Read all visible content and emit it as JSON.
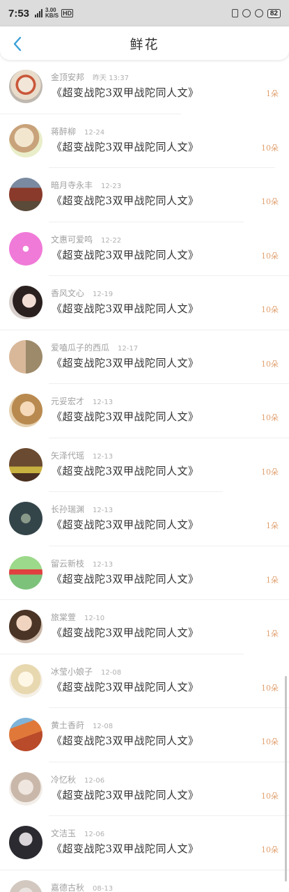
{
  "status_bar": {
    "time": "7:53",
    "net_speed_value": "3.00",
    "net_speed_unit": "KB/S",
    "hd": "HD",
    "battery": "82"
  },
  "header": {
    "title": "鲜花"
  },
  "colors": {
    "flower_count": "#e0a070",
    "meta_text": "#a0a0a0",
    "title_text": "#333333"
  },
  "rows": [
    {
      "name": "金顶安邦",
      "date": "昨天 13:37",
      "book": "《超变战陀3双甲战陀同人文》",
      "count": "1朵",
      "avatar": "food-bowl"
    },
    {
      "name": "蒋醉柳",
      "date": "12-24",
      "book": "《超变战陀3双甲战陀同人文》",
      "count": "10朵",
      "avatar": "girl-portrait"
    },
    {
      "name": "暗月寺永丰",
      "date": "12-23",
      "book": "《超变战陀3双甲战陀同人文》",
      "count": "10朵",
      "avatar": "temple-building"
    },
    {
      "name": "文惠可爱鸣",
      "date": "12-22",
      "book": "《超变战陀3双甲战陀同人文》",
      "count": "10朵",
      "avatar": "pink-graphic"
    },
    {
      "name": "香风文心",
      "date": "12-19",
      "book": "《超变战陀3双甲战陀同人文》",
      "count": "10朵",
      "avatar": "dark-hair-girl"
    },
    {
      "name": "爱嗑瓜子的西瓜",
      "date": "12-17",
      "book": "《超变战陀3双甲战陀同人文》",
      "count": "10朵",
      "avatar": "anime-pair"
    },
    {
      "name": "元妥宏才",
      "date": "12-13",
      "book": "《超变战陀3双甲战陀同人文》",
      "count": "10朵",
      "avatar": "blonde-girl"
    },
    {
      "name": "矢泽代瑶",
      "date": "12-13",
      "book": "《超变战陀3双甲战陀同人文》",
      "count": "10朵",
      "avatar": "warm-photo"
    },
    {
      "name": "长孙瑞渊",
      "date": "12-13",
      "book": "《超变战陀3双甲战陀同人文》",
      "count": "1朵",
      "avatar": "forest-girl"
    },
    {
      "name": "留云新枝",
      "date": "12-13",
      "book": "《超变战陀3双甲战陀同人文》",
      "count": "1朵",
      "avatar": "cartoon-scene"
    },
    {
      "name": "旅棠萱",
      "date": "12-10",
      "book": "《超变战陀3双甲战陀同人文》",
      "count": "1朵",
      "avatar": "woman-photo"
    },
    {
      "name": "冰莹小娘子",
      "date": "12-08",
      "book": "《超变战陀3双甲战陀同人文》",
      "count": "10朵",
      "avatar": "anime-white"
    },
    {
      "name": "黄土香莳",
      "date": "12-08",
      "book": "《超变战陀3双甲战陀同人文》",
      "count": "10朵",
      "avatar": "desert-canyon"
    },
    {
      "name": "冷忆秋",
      "date": "12-06",
      "book": "《超变战陀3双甲战陀同人文》",
      "count": "10朵",
      "avatar": "soft-portrait"
    },
    {
      "name": "文洁玉",
      "date": "12-06",
      "book": "《超变战陀3双甲战陀同人文》",
      "count": "10朵",
      "avatar": "dark-anime"
    },
    {
      "name": "嘉德古秋",
      "date": "08-13",
      "book": "",
      "count": "",
      "avatar": "light-portrait"
    }
  ]
}
